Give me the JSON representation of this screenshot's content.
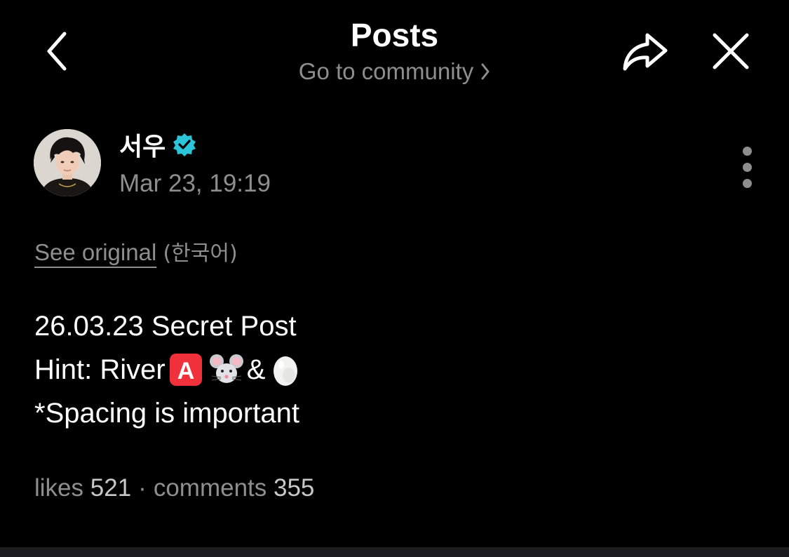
{
  "header": {
    "title": "Posts",
    "community_link": "Go to community"
  },
  "post": {
    "author_name": "서우",
    "verified": true,
    "timestamp": "Mar 23, 19:19",
    "see_original_label": "See original",
    "original_language": "(한국어)",
    "body": {
      "line1": "26.03.23 Secret Post",
      "line2_prefix": "Hint: River",
      "line2_emojis": [
        "red-a-button-emoji",
        "mouse-face-emoji",
        "egg-emoji"
      ],
      "line2_ampersand": "&",
      "line3": "*Spacing is important"
    },
    "stats": {
      "likes_label": "likes",
      "likes_count": "521",
      "separator": "·",
      "comments_label": "comments",
      "comments_count": "355"
    }
  },
  "colors": {
    "background": "#000000",
    "primary_text": "#ffffff",
    "secondary_text": "#8e8e8e",
    "verified_badge": "#2bc4d9",
    "bottom_bar": "#1c1c1e"
  },
  "icons": {
    "back": "chevron-left-icon",
    "share": "share-forward-icon",
    "close": "close-icon",
    "more": "more-vertical-icon",
    "verified": "verified-badge-icon",
    "community_chevron": "chevron-right-icon"
  }
}
